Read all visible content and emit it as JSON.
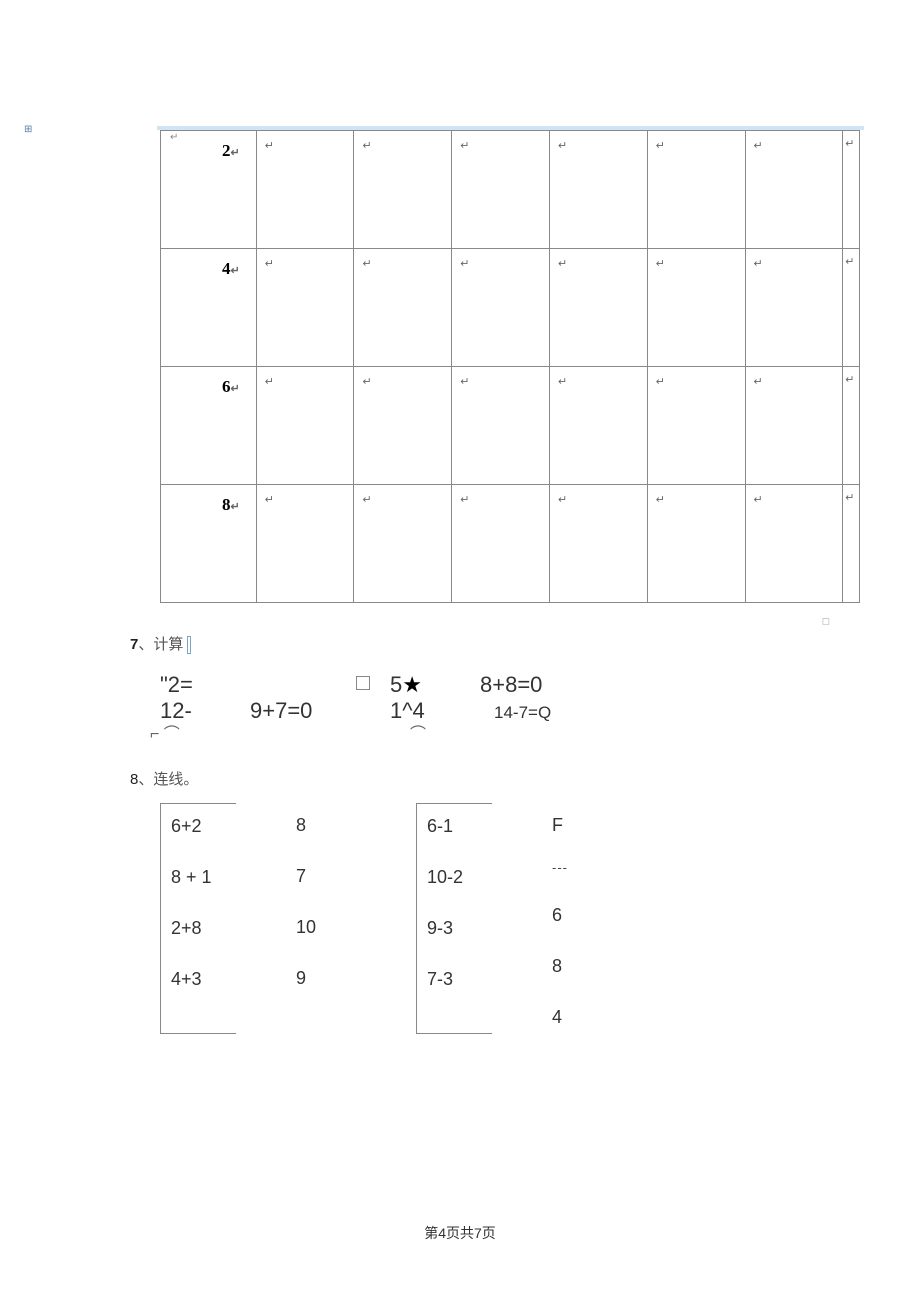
{
  "table": {
    "rows": [
      {
        "head": "2",
        "cells": [
          "↵",
          "↵",
          "↵",
          "↵",
          "↵",
          "↵",
          "↵"
        ]
      },
      {
        "head": "4",
        "cells": [
          "↵",
          "↵",
          "↵",
          "↵",
          "↵",
          "↵",
          "↵"
        ]
      },
      {
        "head": "6",
        "cells": [
          "↵",
          "↵",
          "↵",
          "↵",
          "↵",
          "↵",
          "↵"
        ]
      },
      {
        "head": "8",
        "cells": [
          "↵",
          "↵",
          "↵",
          "↵",
          "↵",
          "↵",
          "↵"
        ]
      }
    ]
  },
  "q7": {
    "num": "7",
    "sep": "、",
    "title": "计算"
  },
  "calc": {
    "r1c1": "\"2=",
    "r1c2_box": "□",
    "r1c3a": "5",
    "r1c3b": "★",
    "r1c4": "8+8=0",
    "r2c1": "12-",
    "r2c2": "9+7=0",
    "r2c3": "1^4",
    "r2c4": "14-7=Q",
    "r3c1": "⌐  ⌒",
    "r3c3": "⌒"
  },
  "q8": {
    "num": "8",
    "sep": "、",
    "title": "连线。"
  },
  "match": {
    "left_expr": [
      "6+2",
      "8 + 1",
      "2+8",
      "4+3"
    ],
    "left_ans": [
      "8",
      "7",
      "10",
      "9"
    ],
    "right_expr": [
      "6-1",
      "10-2",
      "9-3",
      "7-3"
    ],
    "right_ans": [
      "F",
      "6",
      "8",
      "4"
    ],
    "dash": "---"
  },
  "footer": {
    "prefix": "第",
    "page": "4",
    "mid": "页共",
    "total": "7",
    "suffix": "页"
  }
}
